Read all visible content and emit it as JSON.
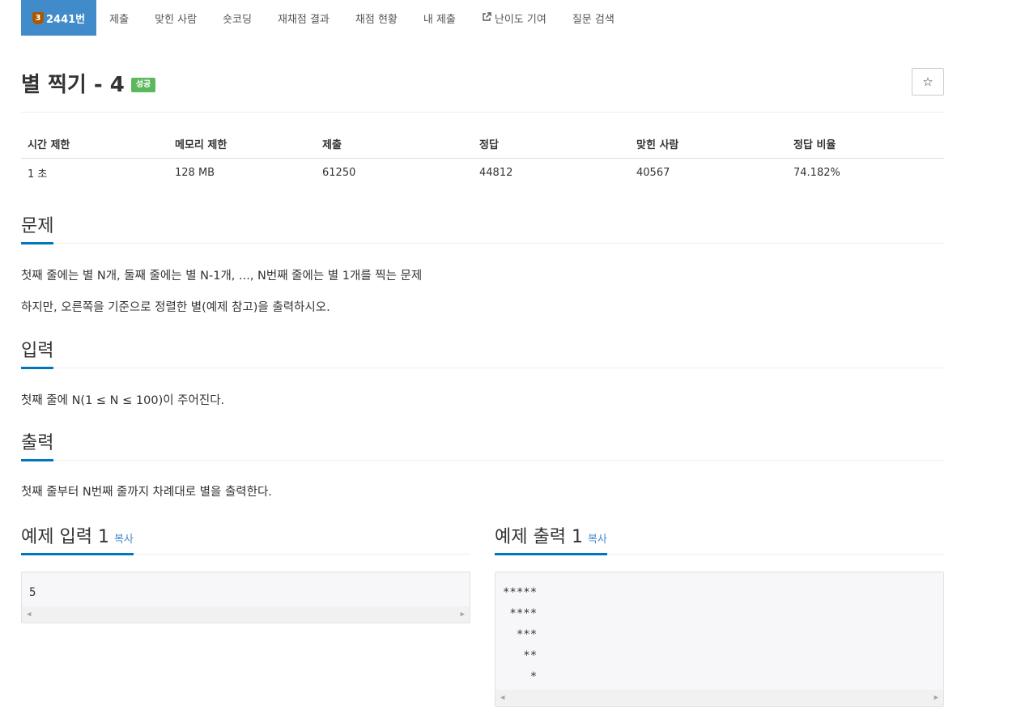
{
  "tabs": [
    {
      "label": "2441번",
      "tier": "3",
      "active": true
    },
    {
      "label": "제출"
    },
    {
      "label": "맞힌 사람"
    },
    {
      "label": "숏코딩"
    },
    {
      "label": "재채점 결과"
    },
    {
      "label": "채점 현황"
    },
    {
      "label": "내 제출"
    },
    {
      "label": "난이도 기여",
      "icon": "external-link-icon"
    },
    {
      "label": "질문 검색"
    }
  ],
  "problem": {
    "title": "별 찍기 - 4",
    "result_badge": "성공",
    "star_label": "☆"
  },
  "info_table": {
    "headers": [
      "시간 제한",
      "메모리 제한",
      "제출",
      "정답",
      "맞힌 사람",
      "정답 비율"
    ],
    "values": [
      "1 초",
      "128 MB",
      "61250",
      "44812",
      "40567",
      "74.182%"
    ]
  },
  "sections": {
    "problem": {
      "heading": "문제",
      "lines": [
        "첫째 줄에는 별 N개, 둘째 줄에는 별 N-1개, ..., N번째 줄에는 별 1개를 찍는 문제",
        "하지만, 오른쪽을 기준으로 정렬한 별(예제 참고)을 출력하시오."
      ]
    },
    "input": {
      "heading": "입력",
      "text": "첫째 줄에 N(1 ≤ N ≤ 100)이 주어진다."
    },
    "output": {
      "heading": "출력",
      "text": "첫째 줄부터 N번째 줄까지 차례대로 별을 출력한다."
    }
  },
  "samples": {
    "input": {
      "heading": "예제 입력 1",
      "copy": "복사",
      "content": "5"
    },
    "output": {
      "heading": "예제 출력 1",
      "copy": "복사",
      "content": "*****\n ****\n  ***\n   **\n    *"
    }
  },
  "colors": {
    "active_tab": "#428bca",
    "tier_badge": "#ad5600",
    "success_badge": "#5cb85c",
    "section_underline": "#0076c0",
    "link": "#428bca"
  }
}
